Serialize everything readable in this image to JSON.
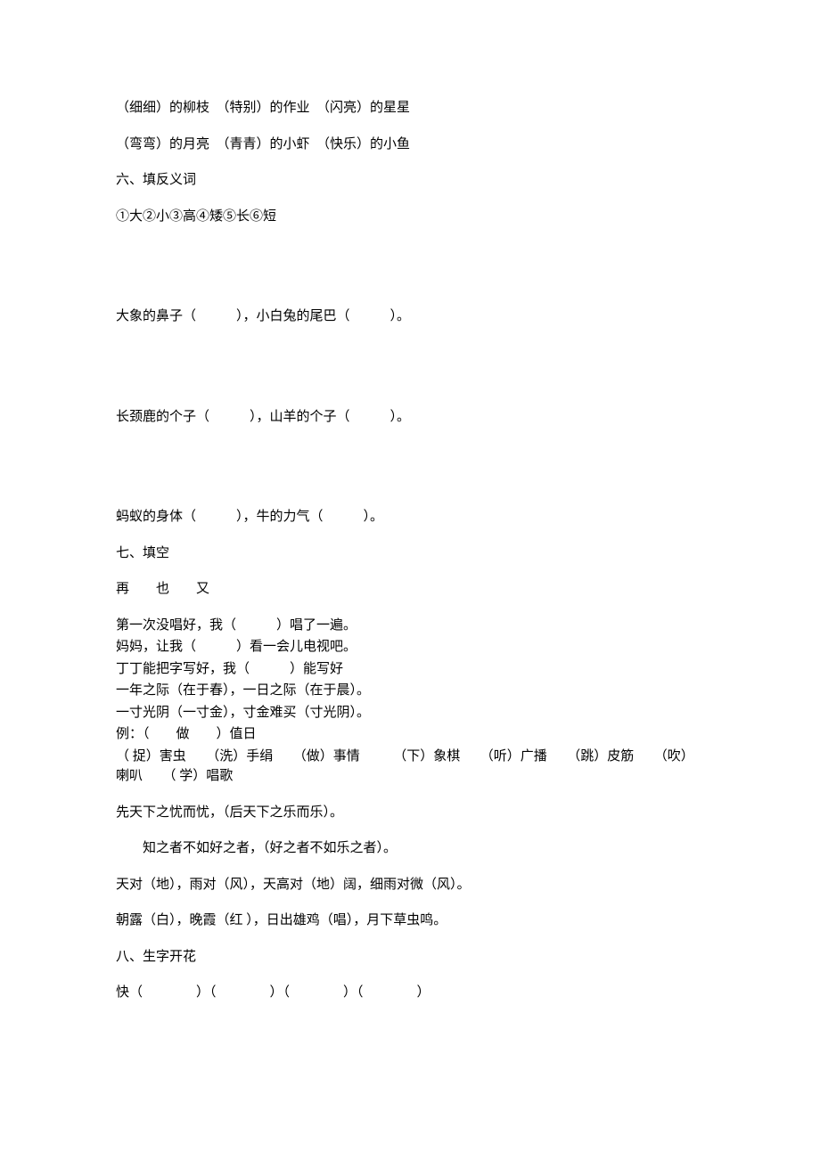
{
  "p1": "（细细）的柳枝　（特别）的作业　（闪亮）的星星",
  "p2": "（弯弯）的月亮　（青青）的小虾　（快乐）的小鱼",
  "h6": "六、填反义词",
  "p3": "①大②小③高④矮⑤长⑥短",
  "q6a": "大象的鼻子（　　　），小白兔的尾巴（　　　）。",
  "q6b": "长颈鹿的个子（　　　），山羊的个子（　　　）。",
  "q6c": "蚂蚁的身体（　　　），牛的力气（　　　）。",
  "h7": "七、填空",
  "p4": "再　　也　　又",
  "s7a": "第一次没唱好，我（　　　）唱了一遍。",
  "s7b": "妈妈，让我（　　　）看一会儿电视吧。",
  "s7c": "丁丁能把字写好，我（　　　）能写好",
  "s7d": "一年之际（在于春），一日之际（在于晨）。",
  "s7e": "一寸光阴（一寸金），寸金难买（寸光阴）。",
  "s7f": "例：（　　做　　）值日",
  "s7g": "（ 捉）害虫　　（洗）手绢　　（做）事情　　　（下）象棋　　（听）广播　　（跳）皮筋　　（吹）喇叭　　（ 学）唱歌",
  "s7h": "先天下之忧而忧，（后天下之乐而乐）。",
  "s7i": "知之者不如好之者，（好之者不如乐之者）。",
  "s7j": "天对（地），雨对（风），天高对（地）阔，细雨对微（风）。",
  "s7k": "朝露（白），晚霞（红 ），日出雄鸡（唱），月下草虫鸣。",
  "h8": "八、生字开花",
  "p8": "快（　　　　）（　　　　）（　　　　）（　　　　）"
}
